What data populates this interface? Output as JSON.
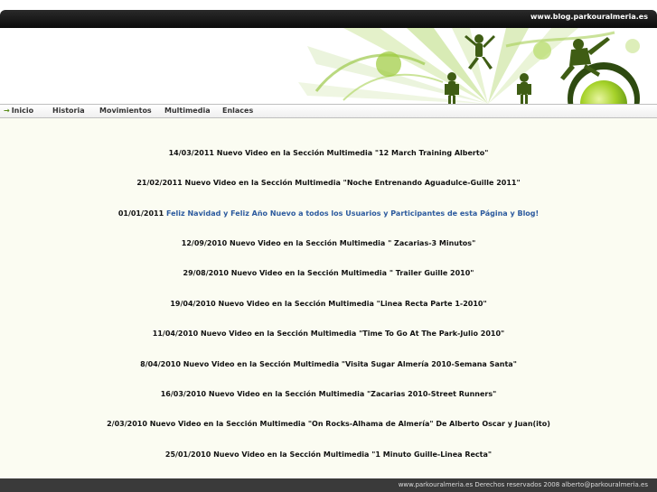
{
  "header": {
    "site_url": "www.blog.parkouralmeria.es"
  },
  "nav": {
    "items": [
      {
        "label": "Inicio",
        "active": true
      },
      {
        "label": "Historia"
      },
      {
        "label": "Movimientos"
      },
      {
        "label": "Multimedia"
      },
      {
        "label": "Enlaces"
      }
    ]
  },
  "news": [
    {
      "date": "14/03/2011",
      "text": "Nuevo Video en la Sección Multimedia \"12 March Training Alberto\""
    },
    {
      "date": "21/02/2011",
      "text": "Nuevo Video en la Sección Multimedia \"Noche Entrenando Aguadulce-Guille 2011\""
    },
    {
      "date": "01/01/2011",
      "text": "Feliz Navidad y Feliz Año Nuevo a todos los Usuarios y Participantes de esta Página y Blog!",
      "highlight": true
    },
    {
      "date": "12/09/2010",
      "text": "Nuevo Video en la Sección Multimedia \" Zacarias-3 Minutos\""
    },
    {
      "date": "29/08/2010",
      "text": "Nuevo Video en la Sección Multimedia \" Trailer Guille 2010\""
    },
    {
      "date": "19/04/2010",
      "text": "Nuevo Video en la Sección Multimedia \"Linea Recta Parte 1-2010\""
    },
    {
      "date": "11/04/2010",
      "text": "Nuevo Video en la Sección Multimedia \"Time To Go At The Park-Julio 2010\""
    },
    {
      "date": "8/04/2010",
      "text": "Nuevo Video en la Sección Multimedia \"Visita Sugar Almería 2010-Semana Santa\""
    },
    {
      "date": "16/03/2010",
      "text": "Nuevo Video en la Sección Multimedia \"Zacarias 2010-Street Runners\""
    },
    {
      "date": "2/03/2010",
      "text": "Nuevo Video en la Sección Multimedia \"On Rocks-Alhama de Almería\" De Alberto Oscar y Juan(ito)"
    },
    {
      "date": "25/01/2010",
      "text": "Nuevo Video en la Sección Multimedia \"1 Minuto Guille-Linea Recta\""
    }
  ],
  "footer": {
    "text": "www.parkouralmeria.es Derechos reservados 2008 alberto@parkouralmeria.es"
  },
  "colors": {
    "accent_green": "#8cc63f",
    "link_blue": "#2c5a9e",
    "content_bg": "#fbfcf2"
  }
}
